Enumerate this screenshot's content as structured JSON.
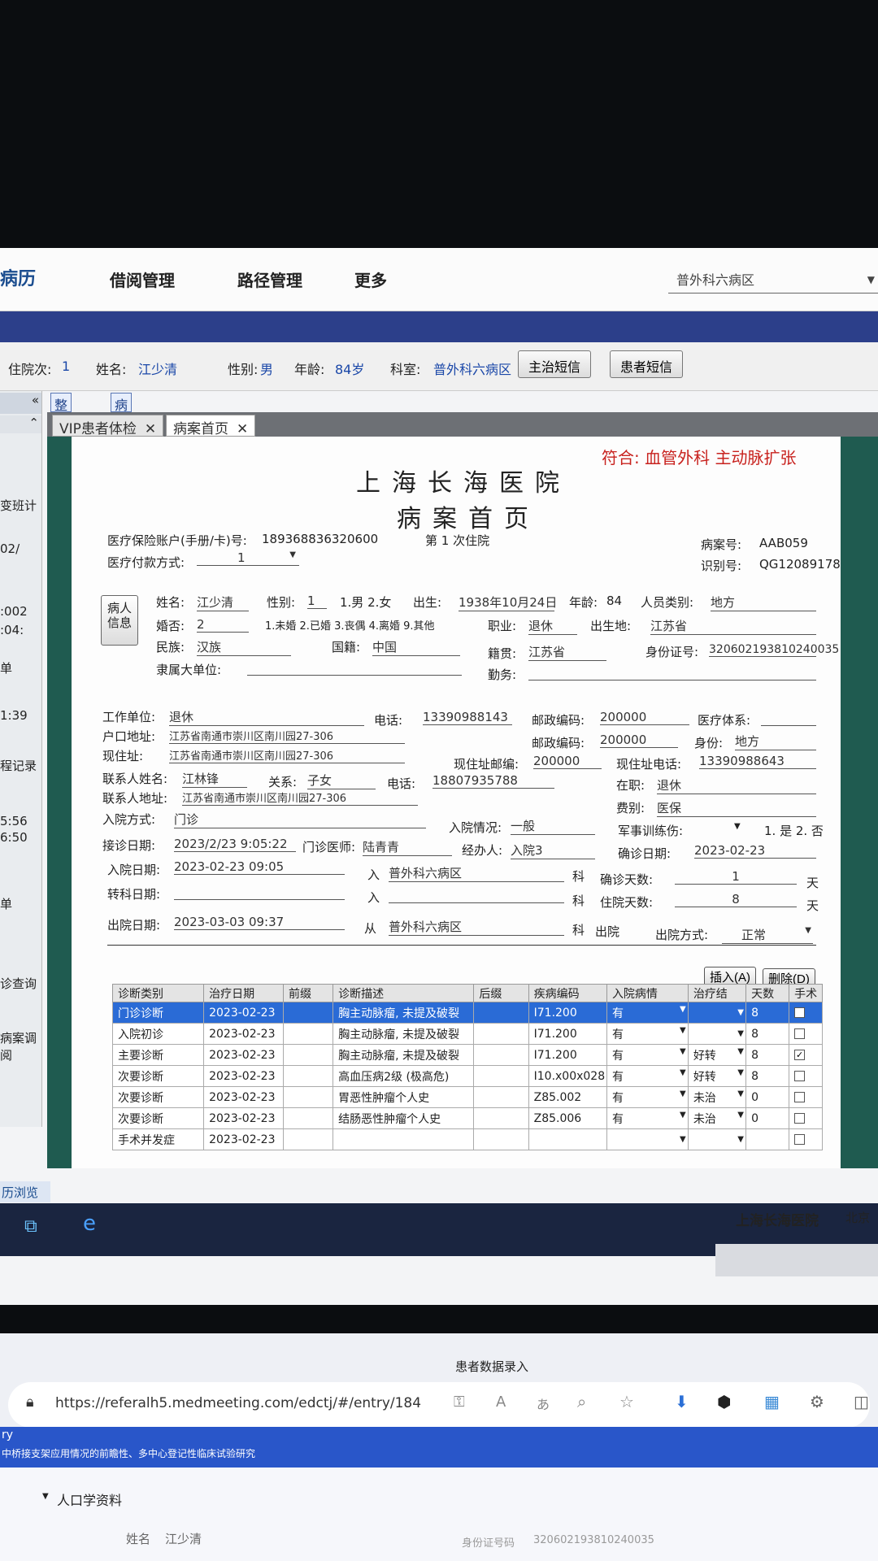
{
  "topnav": {
    "brand": "病历",
    "items": [
      "借阅管理",
      "路径管理",
      "更多"
    ],
    "ward": "普外科六病区"
  },
  "patientbar": {
    "visit_label": "住院次:",
    "visit": "1",
    "name_label": "姓名:",
    "name": "江少清",
    "sex_label": "性别:",
    "sex": "男",
    "age_label": "年龄:",
    "age": "84岁",
    "dept_label": "科室:",
    "dept": "普外科六病区",
    "btn_doctor": "主治短信",
    "btn_patient": "患者短信"
  },
  "toolbar": {
    "print_all": "整体打印",
    "view_progress": "病程连续查看"
  },
  "tabs": [
    {
      "label": "VIP患者体检"
    },
    {
      "label": "病案首页"
    }
  ],
  "left_rail": [
    "变班计",
    "02/",
    ":002",
    ":04:",
    "单",
    "1:39",
    "程记录",
    "5:56",
    "6:50",
    "单",
    "诊查询",
    "病案调阅"
  ],
  "doc": {
    "diagnosis_match": "符合: 血管外科 主动脉扩张",
    "hospital": "上海长海医院",
    "form_title": "病案首页",
    "insurance_label": "医疗保险账户(手册/卡)号:",
    "insurance": "189368836320600",
    "admission_no": "第 1 次住院",
    "case_no_label": "病案号:",
    "case_no": "AAB059",
    "id_no_label": "识别号:",
    "id_no": "QG12089178",
    "pay_label": "医疗付款方式:",
    "pay": "1",
    "patient_info_btn": "病人信息",
    "name_label": "姓名:",
    "name": "江少清",
    "sex_label": "性别:",
    "sex": "1",
    "sex_opts": "1.男 2.女",
    "birth_label": "出生:",
    "birth": "1938年10月24日",
    "age_label": "年龄:",
    "age": "84",
    "ptype_label": "人员类别:",
    "ptype": "地方",
    "marital_label": "婚否:",
    "marital": "2",
    "marital_opts": "1.未婚 2.已婚 3.丧偶 4.离婚 9.其他",
    "job_label": "职业:",
    "job": "退休",
    "birthplace_label": "出生地:",
    "birthplace": "江苏省",
    "ethnic_label": "民族:",
    "ethnic": "汉族",
    "nation_label": "国籍:",
    "nation": "中国",
    "native_label": "籍贯:",
    "native": "江苏省",
    "idcard_label": "身份证号:",
    "idcard": "320602193810240035",
    "unit_label": "隶属大单位:",
    "duty_label": "勤务:",
    "work_label": "工作单位:",
    "work": "退休",
    "phone_label": "电话:",
    "phone": "13390988143",
    "zip_label": "邮政编码:",
    "zip": "200000",
    "medsys_label": "医疗体系:",
    "hukou_label": "户口地址:",
    "hukou": "江苏省南通市崇川区南川园27-306",
    "zip2_label": "邮政编码:",
    "zip2": "200000",
    "identity_label": "身份:",
    "identity": "地方",
    "addr_label": "现住址:",
    "addr": "江苏省南通市崇川区南川园27-306",
    "addrzip_label": "现住址邮编:",
    "addrzip": "200000",
    "addrphone_label": "现住址电话:",
    "addrphone": "13390988643",
    "contact_label": "联系人姓名:",
    "contact": "江林锋",
    "relation_label": "关系:",
    "relation": "子女",
    "cphone_label": "电话:",
    "cphone": "18807935788",
    "onduty_label": "在职:",
    "onduty": "退休",
    "caddr_label": "联系人地址:",
    "caddr": "江苏省南通市崇川区南川园27-306",
    "fee_label": "费别:",
    "fee": "医保",
    "admway_label": "入院方式:",
    "admway": "门诊",
    "admstate_label": "入院情况:",
    "admstate": "一般",
    "military_label": "军事训练伤:",
    "military_opts": "1. 是 2. 否",
    "consult_label": "接诊日期:",
    "consult": "2023/2/23 9:05:22",
    "opdoc_label": "门诊医师:",
    "opdoc": "陆青青",
    "handler_label": "经办人:",
    "handler": "入院3",
    "confirm_label": "确诊日期:",
    "confirm": "2023-02-23",
    "admdate_label": "入院日期:",
    "admdate": "2023-02-23 09:05",
    "in_label": "入",
    "admward": "普外科六病区",
    "ke": "科",
    "confirmdays_label": "确诊天数:",
    "confirmdays": "1",
    "tian": "天",
    "transfer_label": "转科日期:",
    "staydays_label": "住院天数:",
    "staydays": "8",
    "discharge_label": "出院日期:",
    "discharge": "2023-03-03 09:37",
    "from_label": "从",
    "dischward": "普外科六病区",
    "out_label": "出院",
    "outway_label": "出院方式:",
    "outway": "正常",
    "btn_insert": "插入(A)",
    "btn_delete": "删除(D)"
  },
  "diag": {
    "headers": [
      "诊断类别",
      "治疗日期",
      "前缀",
      "诊断描述",
      "后缀",
      "疾病编码",
      "入院病情",
      "治疗结",
      "天数",
      "手术"
    ],
    "rows": [
      {
        "cat": "门诊诊断",
        "date": "2023-02-23",
        "desc": "胸主动脉瘤, 未提及破裂",
        "code": "I71.200",
        "cond": "有",
        "result": "",
        "days": "8",
        "surg": false
      },
      {
        "cat": "入院初诊",
        "date": "2023-02-23",
        "desc": "胸主动脉瘤, 未提及破裂",
        "code": "I71.200",
        "cond": "有",
        "result": "",
        "days": "8",
        "surg": false
      },
      {
        "cat": "主要诊断",
        "date": "2023-02-23",
        "desc": "胸主动脉瘤, 未提及破裂",
        "code": "I71.200",
        "cond": "有",
        "result": "好转",
        "days": "8",
        "surg": true
      },
      {
        "cat": "次要诊断",
        "date": "2023-02-23",
        "desc": "高血压病2级 (极高危)",
        "code": "I10.x00x028",
        "cond": "有",
        "result": "好转",
        "days": "8",
        "surg": false
      },
      {
        "cat": "次要诊断",
        "date": "2023-02-23",
        "desc": "胃恶性肿瘤个人史",
        "code": "Z85.002",
        "cond": "有",
        "result": "未治",
        "days": "0",
        "surg": false
      },
      {
        "cat": "次要诊断",
        "date": "2023-02-23",
        "desc": "结肠恶性肿瘤个人史",
        "code": "Z85.006",
        "cond": "有",
        "result": "未治",
        "days": "0",
        "surg": false
      },
      {
        "cat": "手术并发症",
        "date": "2023-02-23",
        "desc": "",
        "code": "",
        "cond": "",
        "result": "",
        "days": "",
        "surg": false
      }
    ]
  },
  "bottom": {
    "tab": "历浏览",
    "hospital": "上海长海医院",
    "clock": "北京"
  },
  "browser": {
    "title": "患者数据录入",
    "url": "https://referalh5.medmeeting.com/edctj/#/entry/184",
    "banner_l1": "ry",
    "banner_l2": "中桥接支架应用情况的前瞻性、多中心登记性临床试验研究",
    "section": "人口学资料",
    "name_label": "姓名",
    "name": "江少清",
    "id_label": "身份证号码",
    "id": "320602193810240035"
  }
}
